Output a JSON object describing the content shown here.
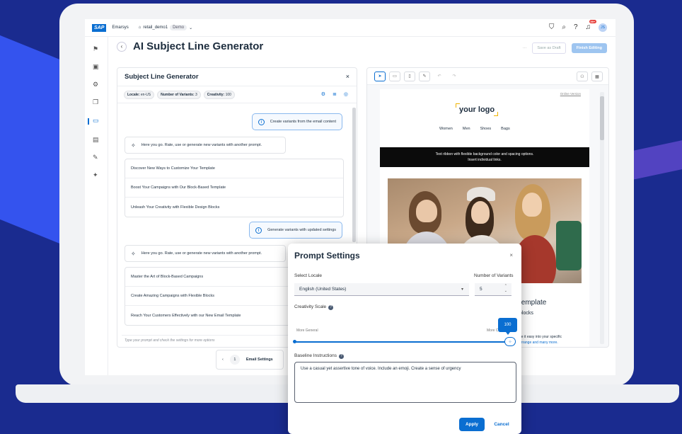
{
  "topbar": {
    "logo": "SAP",
    "app_name": "Emarsys",
    "workspace": "retail_demo1",
    "workspace_badge": "Demo",
    "notification_count": "99+",
    "avatar_initials": "JS"
  },
  "header": {
    "back": "‹",
    "title": "AI Subject Line Generator",
    "more": "···",
    "save_draft": "Save as Draft",
    "finish": "Finish Editing"
  },
  "generator": {
    "title": "Subject Line Generator",
    "close": "×",
    "chips": [
      {
        "label": "Locale:",
        "value": "en-US"
      },
      {
        "label": "Number of Variants:",
        "value": "3"
      },
      {
        "label": "Creativity:",
        "value": "100"
      }
    ],
    "user_msg_1": "Create variants from the email content",
    "ai_msg": "Here you go. Rate, use or generate new variants with another prompt.",
    "variants_1": [
      "Discover New Ways to Customize Your Template",
      "Boost Your Campaigns with Our Block-Based Template",
      "Unleash Your Creativity with Flexible Design Blocks"
    ],
    "user_msg_2": "Generate variants with updated settings",
    "variants_2": [
      "Master the Art of Block-Based Campaigns",
      "Create Amazing Campaigns with Flexible Blocks",
      "Reach Your Customers Effectively with our New Email Template"
    ],
    "prompt_placeholder": "Type your prompt and check the settings for more options"
  },
  "pager": {
    "prev": "‹",
    "page": "1",
    "label": "Email Settings"
  },
  "email_preview": {
    "online_version": "Online Version",
    "logo": "your logo",
    "nav": [
      "Women",
      "Men",
      "Shoes",
      "Bags"
    ],
    "ribbon_line1": "Text ribbon with flexible background color and spacing options.",
    "ribbon_line2": "Insert individual links.",
    "text1": "template",
    "text2": "blocks",
    "text3a": "ge it easy into your specific",
    "text3b": "arrange and many more."
  },
  "dialog": {
    "title": "Prompt Settings",
    "close": "×",
    "locale_label": "Select Locale",
    "locale_value": "English (United States)",
    "variants_label": "Number of Variants",
    "variants_value": "5",
    "creativity_label": "Creativity Scale",
    "creativity_value": "100",
    "creativity_level": 1.0,
    "min_label": "More General",
    "max_label": "More Creative",
    "baseline_label": "Baseline Instructions",
    "baseline_text": "Use a casual yet assertive tone of voice. Include an emoji. Create a sense of urgency",
    "apply": "Apply",
    "cancel": "Cancel"
  },
  "colors": {
    "background": "#1a2b8f",
    "accent": "#0a6ed1"
  }
}
